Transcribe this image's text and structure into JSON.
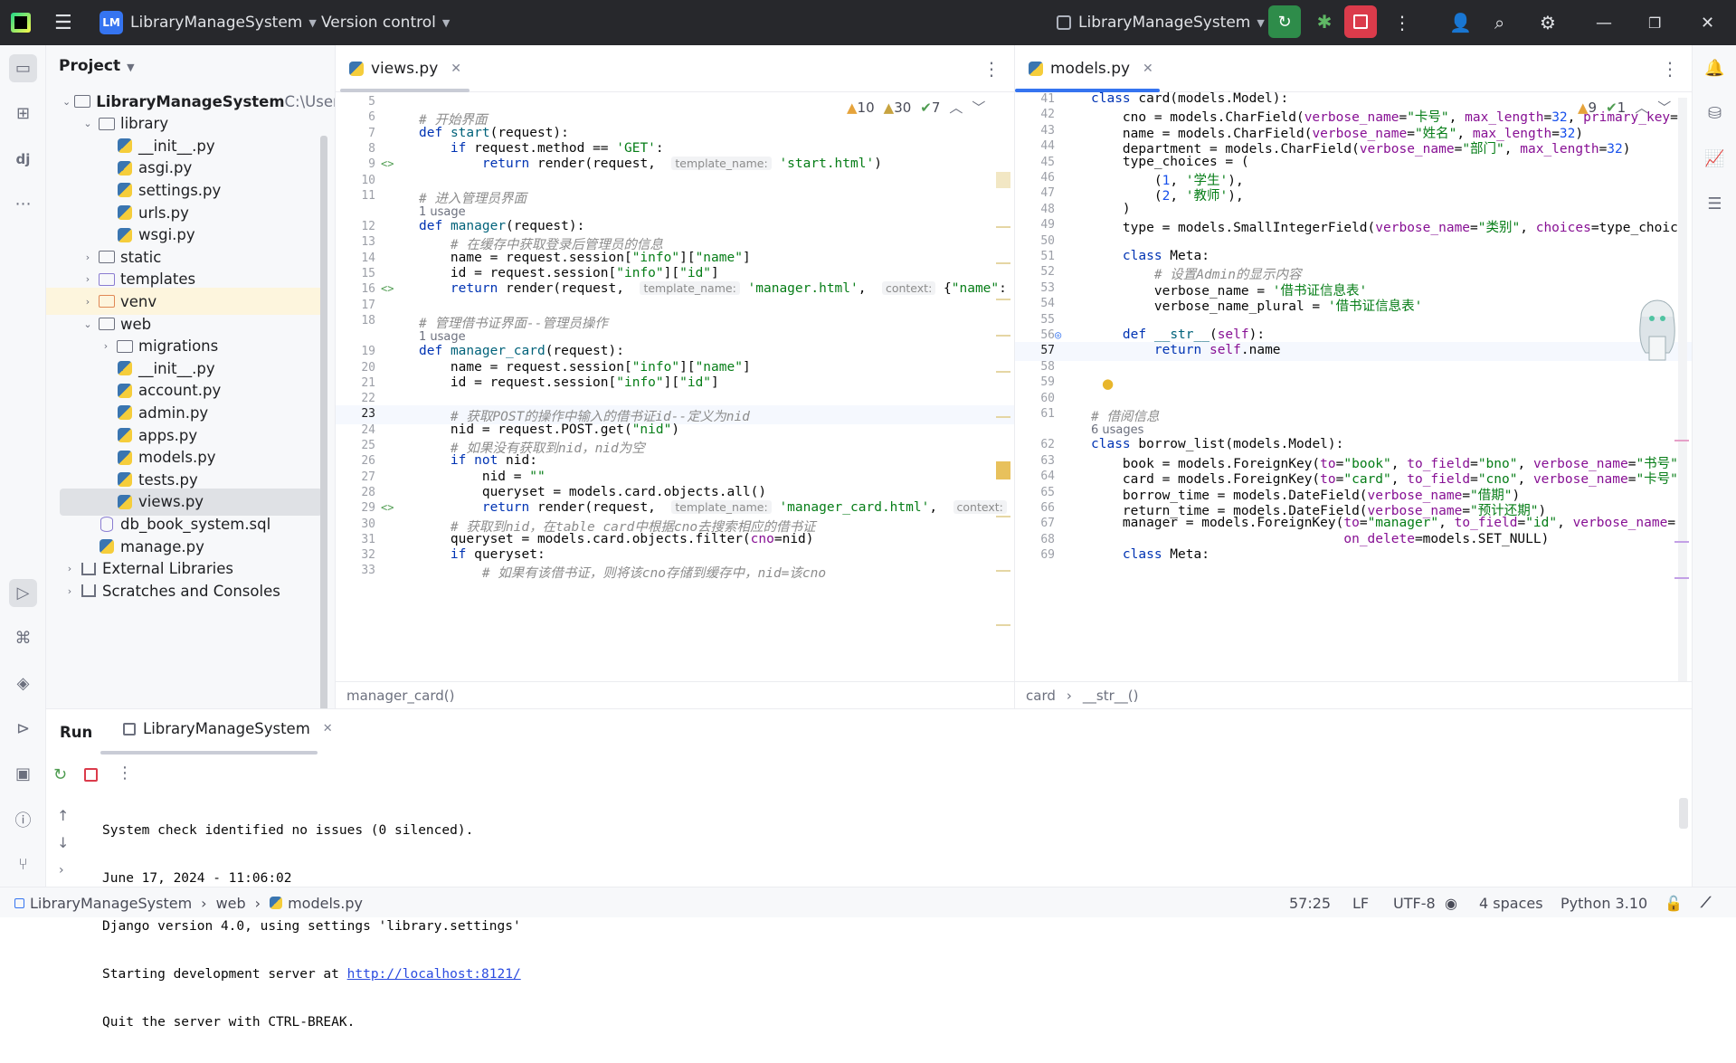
{
  "titlebar": {
    "project_badge": "LM",
    "project_name": "LibraryManageSystem",
    "vcs": "Version control",
    "run_config": "LibraryManageSystem"
  },
  "project_panel": {
    "title": "Project",
    "tree": [
      {
        "label": "LibraryManageSystem",
        "suffix": "C:\\User",
        "depth": 0,
        "kind": "folder",
        "expanded": true
      },
      {
        "label": "library",
        "depth": 1,
        "kind": "folder",
        "expanded": true
      },
      {
        "label": "__init__.py",
        "depth": 2,
        "kind": "py"
      },
      {
        "label": "asgi.py",
        "depth": 2,
        "kind": "py"
      },
      {
        "label": "settings.py",
        "depth": 2,
        "kind": "py"
      },
      {
        "label": "urls.py",
        "depth": 2,
        "kind": "py"
      },
      {
        "label": "wsgi.py",
        "depth": 2,
        "kind": "py"
      },
      {
        "label": "static",
        "depth": 1,
        "kind": "folder",
        "expanded": false
      },
      {
        "label": "templates",
        "depth": 1,
        "kind": "folder-purple",
        "expanded": false
      },
      {
        "label": "venv",
        "depth": 1,
        "kind": "folder-orange",
        "expanded": false
      },
      {
        "label": "web",
        "depth": 1,
        "kind": "folder",
        "expanded": true
      },
      {
        "label": "migrations",
        "depth": 2,
        "kind": "folder",
        "expanded": false
      },
      {
        "label": "__init__.py",
        "depth": 2,
        "kind": "py"
      },
      {
        "label": "account.py",
        "depth": 2,
        "kind": "py"
      },
      {
        "label": "admin.py",
        "depth": 2,
        "kind": "py"
      },
      {
        "label": "apps.py",
        "depth": 2,
        "kind": "py"
      },
      {
        "label": "models.py",
        "depth": 2,
        "kind": "py"
      },
      {
        "label": "tests.py",
        "depth": 2,
        "kind": "py"
      },
      {
        "label": "views.py",
        "depth": 2,
        "kind": "py",
        "selected": true
      },
      {
        "label": "db_book_system.sql",
        "depth": 1,
        "kind": "sql"
      },
      {
        "label": "manage.py",
        "depth": 1,
        "kind": "py"
      },
      {
        "label": "External Libraries",
        "depth": 0,
        "kind": "lib",
        "expanded": false
      },
      {
        "label": "Scratches and Consoles",
        "depth": 0,
        "kind": "scratch",
        "expanded": false
      }
    ]
  },
  "left_editor": {
    "tab": "views.py",
    "warnings": "10",
    "weak_warnings": "30",
    "ok": "7",
    "breadcrumb": "manager_card()",
    "lines": [
      {
        "n": "5",
        "html": ""
      },
      {
        "n": "6",
        "html": "<span class='cmt'># 开始界面</span>"
      },
      {
        "n": "7",
        "html": "<span class='kw'>def</span> <span class='fn'>start</span>(request):"
      },
      {
        "n": "8",
        "html": "    <span class='kw'>if</span> request.method == <span class='str'>'GET'</span>:"
      },
      {
        "n": "9",
        "html": "        <span class='kw'>return</span> render(request,  <span class='hint'>template_name:</span> <span class='str'>'start.html'</span>)"
      },
      {
        "n": "10",
        "html": ""
      },
      {
        "n": "11",
        "html": "<span class='cmt'># 进入管理员界面</span>"
      },
      {
        "n": "12",
        "html": "<span class='kw'>def</span> <span class='fn'>manager</span>(request):",
        "usage": "1 usage"
      },
      {
        "n": "13",
        "html": "    <span class='cmt'># 在缓存中获取登录后管理员的信息</span>"
      },
      {
        "n": "14",
        "html": "    name = request.session[<span class='str'>\"info\"</span>][<span class='str'>\"name\"</span>]"
      },
      {
        "n": "15",
        "html": "    id = request.session[<span class='str'>\"info\"</span>][<span class='str'>\"id\"</span>]"
      },
      {
        "n": "16",
        "html": "    <span class='kw'>return</span> render(request,  <span class='hint'>template_name:</span> <span class='str'>'manager.html'</span>,  <span class='hint'>context:</span> {<span class='str'>\"name\"</span>:"
      },
      {
        "n": "17",
        "html": ""
      },
      {
        "n": "18",
        "html": "<span class='cmt'># 管理借书证界面--管理员操作</span>"
      },
      {
        "n": "19",
        "html": "<span class='kw'>def</span> <span class='fn'>manager_card</span>(request):",
        "usage": "1 usage"
      },
      {
        "n": "20",
        "html": "    name = request.session[<span class='str'>\"info\"</span>][<span class='str'>\"name\"</span>]"
      },
      {
        "n": "21",
        "html": "    id = request.session[<span class='str'>\"info\"</span>][<span class='str'>\"id\"</span>]"
      },
      {
        "n": "22",
        "html": ""
      },
      {
        "n": "23",
        "html": "    <span class='cmt'># 获取POST的操作中输入的借书证id--定义为nid</span>",
        "current": true
      },
      {
        "n": "24",
        "html": "    nid = request.POST.get(<span class='str'>\"nid\"</span>)"
      },
      {
        "n": "25",
        "html": "    <span class='cmt'># 如果没有获取到nid，nid为空</span>"
      },
      {
        "n": "26",
        "html": "    <span class='kw'>if not</span> nid:"
      },
      {
        "n": "27",
        "html": "        nid = <span class='str'>\"\"</span>"
      },
      {
        "n": "28",
        "html": "        queryset = models.card.objects.all()"
      },
      {
        "n": "29",
        "html": "        <span class='kw'>return</span> render(request,  <span class='hint'>template_name:</span> <span class='str'>'manager_card.html'</span>,  <span class='hint'>context:</span>"
      },
      {
        "n": "30",
        "html": "    <span class='cmt'># 获取到nid，在table card中根据cno去搜索相应的借书证</span>"
      },
      {
        "n": "31",
        "html": "    queryset = models.card.objects.filter(<span class='pm'>cno</span>=nid)"
      },
      {
        "n": "32",
        "html": "    <span class='kw'>if</span> queryset:"
      },
      {
        "n": "33",
        "html": "        <span class='cmt'># 如果有该借书证，则将该cno存储到缓存中，nid=该cno</span>"
      }
    ]
  },
  "right_editor": {
    "tab": "models.py",
    "warnings": "9",
    "ok": "1",
    "breadcrumb_1": "card",
    "breadcrumb_2": "__str__()",
    "lines": [
      {
        "n": "41",
        "html": "<span class='kw'>class</span> card(models.Model):"
      },
      {
        "n": "42",
        "html": "    cno = models.CharField(<span class='pm'>verbose_name</span>=<span class='str'>\"卡号\"</span>, <span class='pm'>max_length</span>=<span class='num'>32</span>, <span class='pm'>primary_key</span>="
      },
      {
        "n": "43",
        "html": "    name = models.CharField(<span class='pm'>verbose_name</span>=<span class='str'>\"姓名\"</span>, <span class='pm'>max_length</span>=<span class='num'>32</span>)"
      },
      {
        "n": "44",
        "html": "    department = models.CharField(<span class='pm'>verbose_name</span>=<span class='str'>\"部门\"</span>, <span class='pm'>max_length</span>=<span class='num'>32</span>)"
      },
      {
        "n": "45",
        "html": "    type_choices = ("
      },
      {
        "n": "46",
        "html": "        (<span class='num'>1</span>, <span class='str'>'学生'</span>),"
      },
      {
        "n": "47",
        "html": "        (<span class='num'>2</span>, <span class='str'>'教师'</span>),"
      },
      {
        "n": "48",
        "html": "    )"
      },
      {
        "n": "49",
        "html": "    type = models.SmallIntegerField(<span class='pm'>verbose_name</span>=<span class='str'>\"类别\"</span>, <span class='pm'>choices</span>=type_choic"
      },
      {
        "n": "50",
        "html": ""
      },
      {
        "n": "51",
        "html": "    <span class='kw'>class</span> Meta:"
      },
      {
        "n": "52",
        "html": "        <span class='cmt'># 设置Admin的显示内容</span>"
      },
      {
        "n": "53",
        "html": "        verbose_name = <span class='str'>'借书证信息表'</span>"
      },
      {
        "n": "54",
        "html": "        verbose_name_plural = <span class='str'>'借书证信息表'</span>"
      },
      {
        "n": "55",
        "html": ""
      },
      {
        "n": "56",
        "html": "    <span class='kw'>def</span> <span class='fn'>__str__</span>(<span class='pm'>self</span>):"
      },
      {
        "n": "57",
        "html": "        <span class='kw'>return</span> <span class='pm'>self</span>.name",
        "current": true
      },
      {
        "n": "58",
        "html": ""
      },
      {
        "n": "59",
        "html": ""
      },
      {
        "n": "60",
        "html": ""
      },
      {
        "n": "61",
        "html": "<span class='cmt'># 借阅信息</span>"
      },
      {
        "n": "62",
        "html": "<span class='kw'>class</span> borrow_list(models.Model):",
        "usage": "6 usages"
      },
      {
        "n": "63",
        "html": "    book = models.ForeignKey(<span class='pm'>to</span>=<span class='str'>\"book\"</span>, <span class='pm'>to_field</span>=<span class='str'>\"bno\"</span>, <span class='pm'>verbose_name</span>=<span class='str'>\"书号\"</span>"
      },
      {
        "n": "64",
        "html": "    card = models.ForeignKey(<span class='pm'>to</span>=<span class='str'>\"card\"</span>, <span class='pm'>to_field</span>=<span class='str'>\"cno\"</span>, <span class='pm'>verbose_name</span>=<span class='str'>\"卡号\"</span>"
      },
      {
        "n": "65",
        "html": "    borrow_time = models.DateField(<span class='pm'>verbose_name</span>=<span class='str'>\"借期\"</span>)"
      },
      {
        "n": "66",
        "html": "    return_time = models.DateField(<span class='pm'>verbose_name</span>=<span class='str'>\"预计还期\"</span>)"
      },
      {
        "n": "67",
        "html": "    manager = models.ForeignKey(<span class='pm'>to</span>=<span class='str'>\"manager\"</span>, <span class='pm'>to_field</span>=<span class='str'>\"id\"</span>, <span class='pm'>verbose_name</span>="
      },
      {
        "n": "68",
        "html": "                                <span class='pm'>on_delete</span>=models.SET_NULL)"
      },
      {
        "n": "69",
        "html": "    <span class='kw'>class</span> Meta:"
      }
    ]
  },
  "run_panel": {
    "tab_run": "Run",
    "tab_config": "LibraryManageSystem",
    "console": [
      "System check identified no issues (0 silenced).",
      "June 17, 2024 - 11:06:02",
      "Django version 4.0, using settings 'library.settings'",
      "Starting development server at ",
      "Quit the server with CTRL-BREAK."
    ],
    "link": "http://localhost:8121/"
  },
  "statusbar": {
    "crumb_1": "LibraryManageSystem",
    "crumb_2": "web",
    "crumb_3": "models.py",
    "position": "57:25",
    "line_sep": "LF",
    "encoding": "UTF-8",
    "indent": "4 spaces",
    "interpreter": "Python 3.10"
  }
}
